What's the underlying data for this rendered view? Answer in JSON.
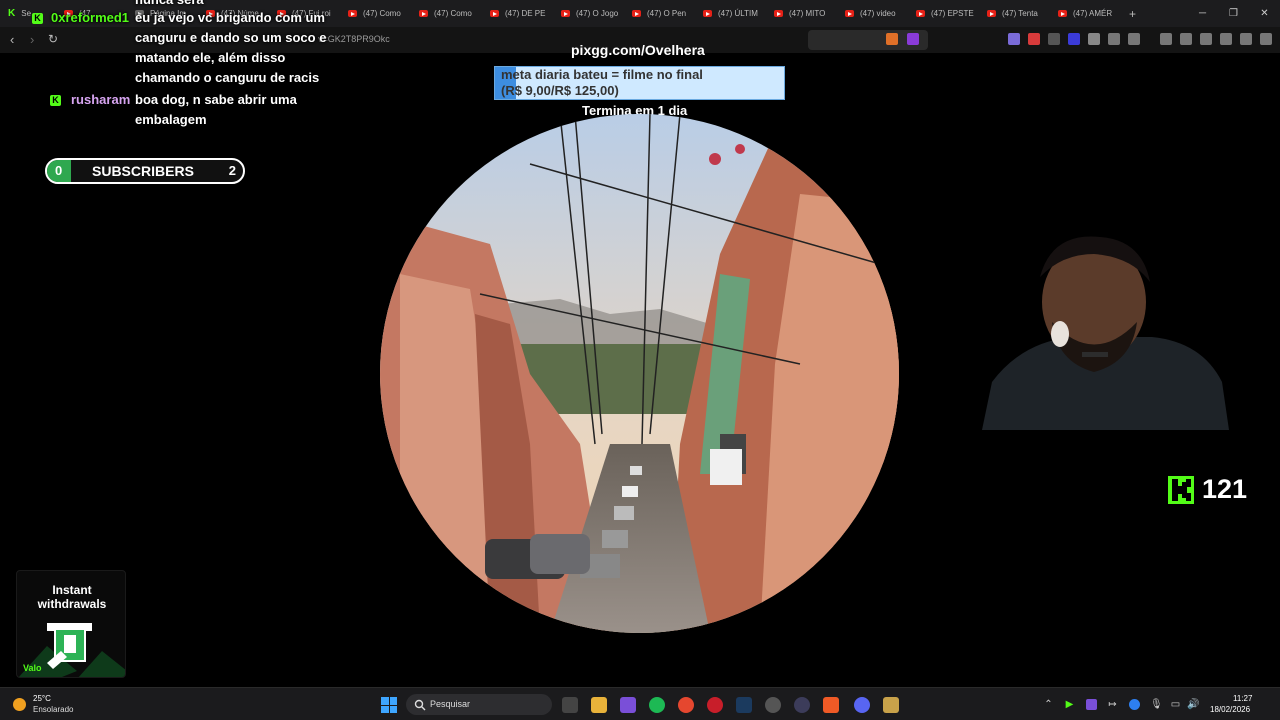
{
  "browser": {
    "tabs": [
      {
        "label": "Se",
        "icon": "kick-icon"
      },
      {
        "label": "(47",
        "icon": "youtube-icon"
      },
      {
        "label": "Página Im",
        "icon": "page-icon"
      },
      {
        "label": "(47) Núme",
        "icon": "youtube-icon"
      },
      {
        "label": "(47) Fui roi",
        "icon": "youtube-icon"
      },
      {
        "label": "(47) Como",
        "icon": "youtube-icon"
      },
      {
        "label": "(47) Como",
        "icon": "youtube-icon"
      },
      {
        "label": "(47) DE PE",
        "icon": "youtube-icon"
      },
      {
        "label": "(47) O Jogo",
        "icon": "youtube-icon"
      },
      {
        "label": "(47) O Pen",
        "icon": "youtube-icon"
      },
      {
        "label": "(47) ÚLTIM",
        "icon": "youtube-icon"
      },
      {
        "label": "(47) MITO",
        "icon": "youtube-icon"
      },
      {
        "label": "(47) video",
        "icon": "youtube-icon"
      },
      {
        "label": "(47) EPSTE",
        "icon": "youtube-icon"
      },
      {
        "label": "(47) Tenta",
        "icon": "youtube-icon"
      },
      {
        "label": "(47) AMÉR",
        "icon": "youtube-icon"
      }
    ],
    "new_tab_label": "+",
    "url_fragment": "v=GK2T8PR9Okc",
    "window_controls": {
      "minimize": "─",
      "maximize": "❐",
      "close": "✕"
    },
    "nav": {
      "back": "‹",
      "forward": "›",
      "reload": "↻"
    }
  },
  "chat": {
    "messages": [
      {
        "username": "0xreformed1",
        "text": "eu ja vejo vc brigando com um"
      },
      {
        "username": "",
        "text": "canguru e dando so um soco e"
      },
      {
        "username": "",
        "text": "matando ele, além disso"
      },
      {
        "username": "",
        "text": "chamando o canguru de racis"
      },
      {
        "username": "rusharam",
        "text": "boa dog, n sabe abrir uma"
      },
      {
        "username": "",
        "text": "embalagem"
      }
    ],
    "partial_top": "nunca sera"
  },
  "subscribers": {
    "current": "0",
    "label": "SUBSCRIBERS",
    "goal": "2",
    "progress": 0
  },
  "donation": {
    "site": "pixgg.com/Ovelhera",
    "goal_title": "meta diaria bateu = filme no final",
    "goal_amount": "(R$ 9,00/R$ 125,00)",
    "progress": 0.072,
    "ends": "Termina em 1 dia"
  },
  "viewers": {
    "count": "121",
    "icon": "kick-logo-icon"
  },
  "ad": {
    "title_line1": "Instant",
    "title_line2": "withdrawals",
    "brand": "Valo"
  },
  "taskbar": {
    "weather_temp": "25°C",
    "weather_desc": "Ensolarado",
    "search_placeholder": "Pesquisar",
    "time": "11:27",
    "date": "18/02/2026"
  },
  "colors": {
    "kick_green": "#53fc18",
    "goal_blue": "#3d8de0",
    "taskbar": "#1b1b1d"
  }
}
